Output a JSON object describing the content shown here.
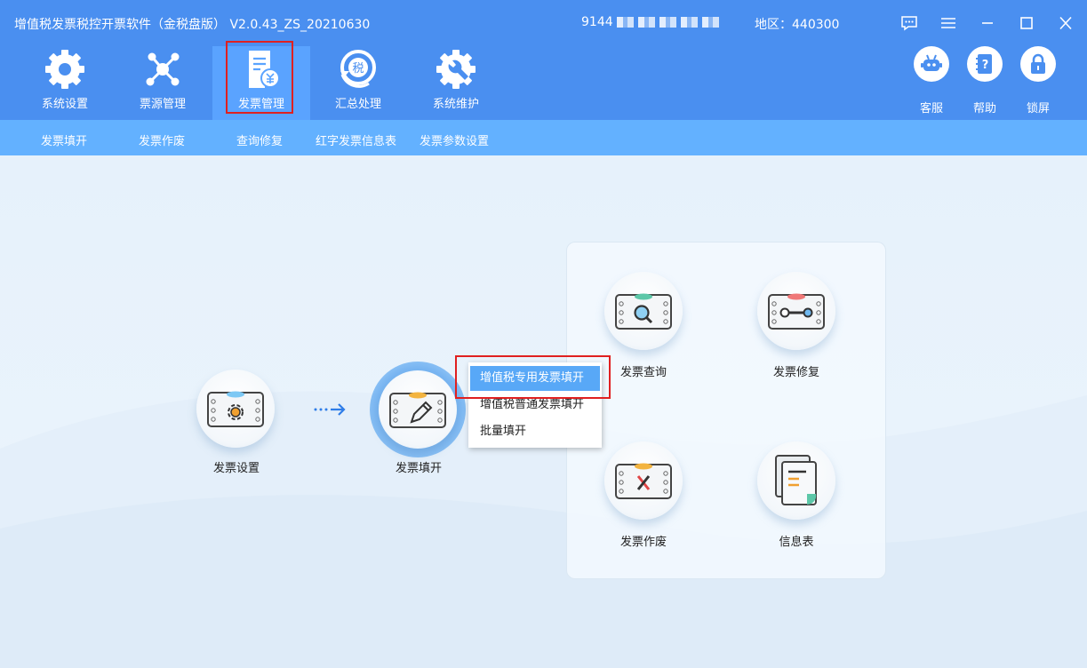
{
  "window": {
    "title": "增值税发票税控开票软件（金税盘版） V2.0.43_ZS_20210630",
    "taxid_prefix": "9144",
    "region": "地区：440300"
  },
  "nav": {
    "tabs": [
      {
        "label": "系统设置",
        "icon": "gear-icon"
      },
      {
        "label": "票源管理",
        "icon": "network-icon"
      },
      {
        "label": "发票管理",
        "icon": "invoice-yen-icon",
        "active": true
      },
      {
        "label": "汇总处理",
        "icon": "tax-refresh-icon"
      },
      {
        "label": "系统维护",
        "icon": "wrench-gear-icon"
      }
    ],
    "tools": [
      {
        "label": "客服",
        "icon": "robot-icon"
      },
      {
        "label": "帮助",
        "icon": "help-book-icon"
      },
      {
        "label": "锁屏",
        "icon": "lock-icon"
      }
    ]
  },
  "subnav": [
    "发票填开",
    "发票作废",
    "查询修复",
    "红字发票信息表",
    "发票参数设置"
  ],
  "flow": {
    "settings": "发票设置",
    "issue": "发票填开",
    "query": "发票查询",
    "repair": "发票修复",
    "void": "发票作废",
    "infotable": "信息表"
  },
  "menu": {
    "items": [
      "增值税专用发票填开",
      "增值税普通发票填开",
      "批量填开"
    ],
    "selected_index": 0
  },
  "colors": {
    "header": "#4a8ff0",
    "active_tab": "#5aa3ff",
    "subnav": "#63b1ff",
    "menu_selected": "#58a8f7",
    "highlight": "#e02020"
  }
}
